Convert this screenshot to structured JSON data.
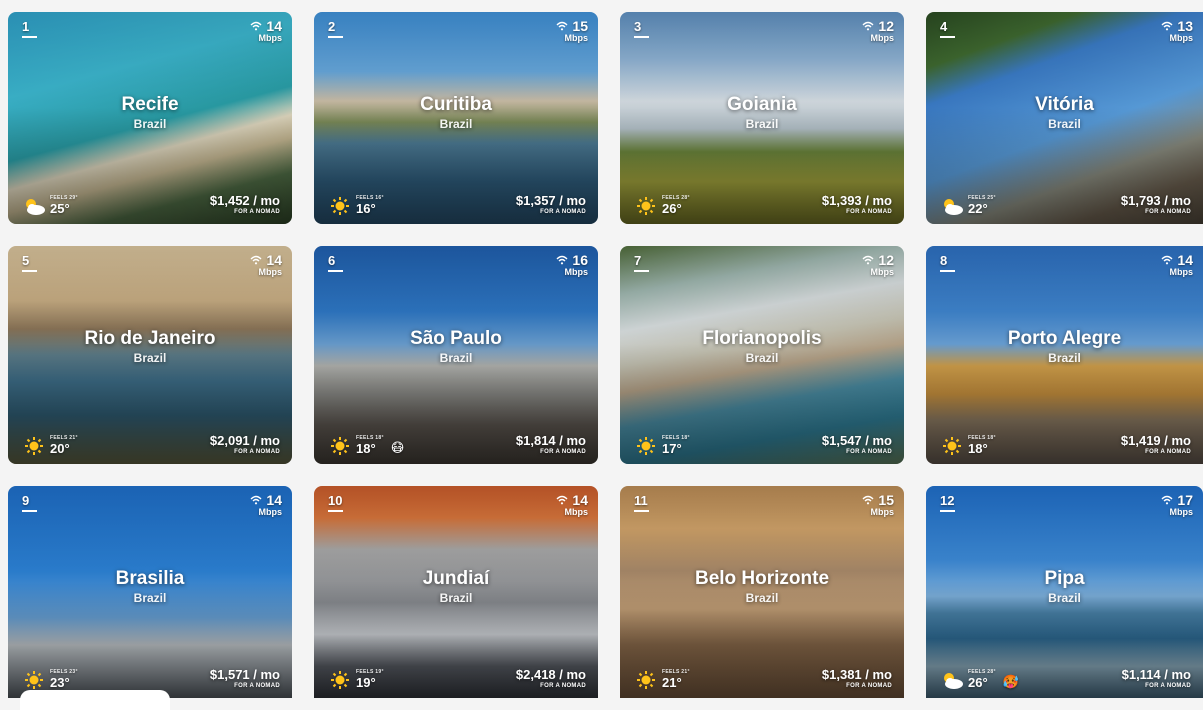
{
  "price_suffix": "FOR A NOMAD",
  "cards": [
    {
      "rank": "1",
      "speed": "14",
      "unit": "Mbps",
      "city": "Recife",
      "country": "Brazil",
      "feels": "FEELS 29°",
      "temp": "25°",
      "weather": "partly-cloudy-icon",
      "price": "$1,452 / mo",
      "extra": ""
    },
    {
      "rank": "2",
      "speed": "15",
      "unit": "Mbps",
      "city": "Curitiba",
      "country": "Brazil",
      "feels": "FEELS 16°",
      "temp": "16°",
      "weather": "sun-icon",
      "price": "$1,357 / mo",
      "extra": ""
    },
    {
      "rank": "3",
      "speed": "12",
      "unit": "Mbps",
      "city": "Goiania",
      "country": "Brazil",
      "feels": "FEELS 28°",
      "temp": "26°",
      "weather": "sun-icon",
      "price": "$1,393 / mo",
      "extra": ""
    },
    {
      "rank": "4",
      "speed": "13",
      "unit": "Mbps",
      "city": "Vitória",
      "country": "Brazil",
      "feels": "FEELS 25°",
      "temp": "22°",
      "weather": "partly-cloudy-icon",
      "price": "$1,793 / mo",
      "extra": ""
    },
    {
      "rank": "5",
      "speed": "14",
      "unit": "Mbps",
      "city": "Rio de Janeiro",
      "country": "Brazil",
      "feels": "FEELS 21°",
      "temp": "20°",
      "weather": "sun-icon",
      "price": "$2,091 / mo",
      "extra": ""
    },
    {
      "rank": "6",
      "speed": "16",
      "unit": "Mbps",
      "city": "São Paulo",
      "country": "Brazil",
      "feels": "FEELS 18°",
      "temp": "18°",
      "weather": "sun-icon",
      "price": "$1,814 / mo",
      "extra": "😷"
    },
    {
      "rank": "7",
      "speed": "12",
      "unit": "Mbps",
      "city": "Florianopolis",
      "country": "Brazil",
      "feels": "FEELS 18°",
      "temp": "17°",
      "weather": "sun-icon",
      "price": "$1,547 / mo",
      "extra": ""
    },
    {
      "rank": "8",
      "speed": "14",
      "unit": "Mbps",
      "city": "Porto Alegre",
      "country": "Brazil",
      "feels": "FEELS 18°",
      "temp": "18°",
      "weather": "sun-icon",
      "price": "$1,419 / mo",
      "extra": ""
    },
    {
      "rank": "9",
      "speed": "14",
      "unit": "Mbps",
      "city": "Brasilia",
      "country": "Brazil",
      "feels": "FEELS 23°",
      "temp": "23°",
      "weather": "sun-icon",
      "price": "$1,571 / mo",
      "extra": ""
    },
    {
      "rank": "10",
      "speed": "14",
      "unit": "Mbps",
      "city": "Jundiaí",
      "country": "Brazil",
      "feels": "FEELS 19°",
      "temp": "19°",
      "weather": "sun-icon",
      "price": "$2,418 / mo",
      "extra": ""
    },
    {
      "rank": "11",
      "speed": "15",
      "unit": "Mbps",
      "city": "Belo Horizonte",
      "country": "Brazil",
      "feels": "FEELS 21°",
      "temp": "21°",
      "weather": "sun-icon",
      "price": "$1,381 / mo",
      "extra": ""
    },
    {
      "rank": "12",
      "speed": "17",
      "unit": "Mbps",
      "city": "Pipa",
      "country": "Brazil",
      "feels": "FEELS 28°",
      "temp": "26°",
      "weather": "partly-cloudy-icon",
      "price": "$1,114 / mo",
      "extra": "🥵"
    }
  ],
  "colors": {
    "text": "#ffffff",
    "page_bg": "#f4f4f4",
    "sun": "#ffc31a"
  }
}
